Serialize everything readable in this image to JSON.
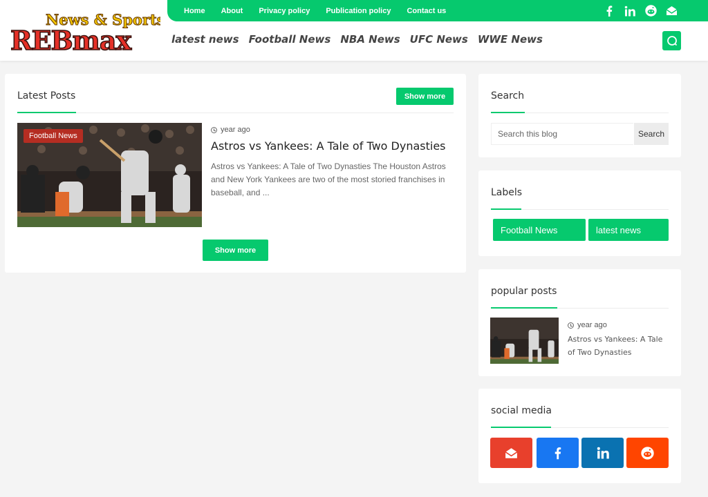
{
  "brand": {
    "logo_top": "News & Sports",
    "logo_main": "REBmax"
  },
  "topnav": [
    "Home",
    "About",
    "Privacy policy",
    "Publication policy",
    "Contact us"
  ],
  "mainnav": [
    "latest news",
    "Football News",
    "NBA News",
    "UFC News",
    "WWE News"
  ],
  "top_social_icons": [
    "facebook-icon",
    "linkedin-icon",
    "reddit-icon",
    "email-icon"
  ],
  "latest": {
    "title": "Latest Posts",
    "show_more_top": "Show more",
    "show_more_bottom": "Show more",
    "post": {
      "label": "Football News",
      "time": "year ago",
      "title": "Astros vs Yankees: A Tale of Two Dynasties",
      "excerpt": "Astros vs Yankees: A Tale of Two Dynasties The Houston Astros and New York Yankees are two of the most storied franchises in baseball, and ..."
    }
  },
  "search": {
    "title": "Search",
    "placeholder": "Search this blog",
    "button": "Search"
  },
  "labels": {
    "title": "Labels",
    "items": [
      "Football News",
      "latest news"
    ]
  },
  "popular": {
    "title": "popular posts",
    "time": "year ago",
    "post_title": "Astros vs Yankees: A Tale of Two Dynasties"
  },
  "social": {
    "title": "social media",
    "buttons": [
      {
        "icon": "email-icon",
        "color": "#e8402c"
      },
      {
        "icon": "facebook-icon",
        "color": "#1877f2"
      },
      {
        "icon": "linkedin-icon",
        "color": "#0a72b1"
      },
      {
        "icon": "reddit-icon",
        "color": "#ff4500"
      }
    ]
  },
  "colors": {
    "accent": "#06c96e",
    "label_red": "#b52d22"
  }
}
